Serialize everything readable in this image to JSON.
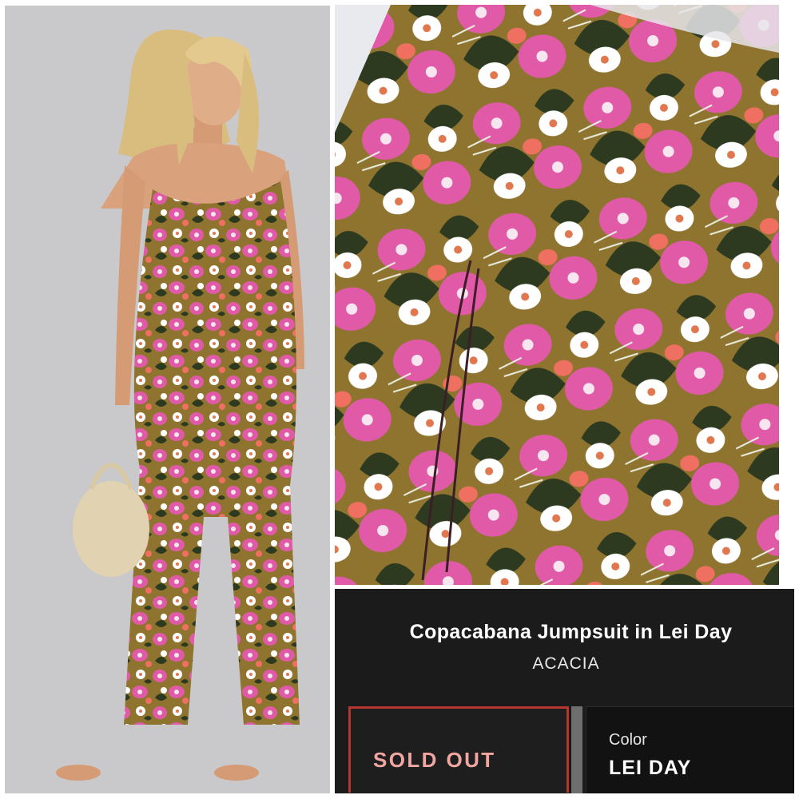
{
  "product": {
    "title": "Copacabana Jumpsuit in Lei Day",
    "brand": "ACACIA",
    "status_label": "SOLD OUT",
    "color_label": "Color",
    "color_value": "LEI DAY"
  },
  "colors": {
    "panel_background": "#1b1b1b",
    "sold_out_border": "#b8352f",
    "sold_out_text": "#f2a6a2",
    "print_base": "#8f7430",
    "print_pink": "#e05aa8",
    "print_leaf": "#2d3a1f"
  }
}
